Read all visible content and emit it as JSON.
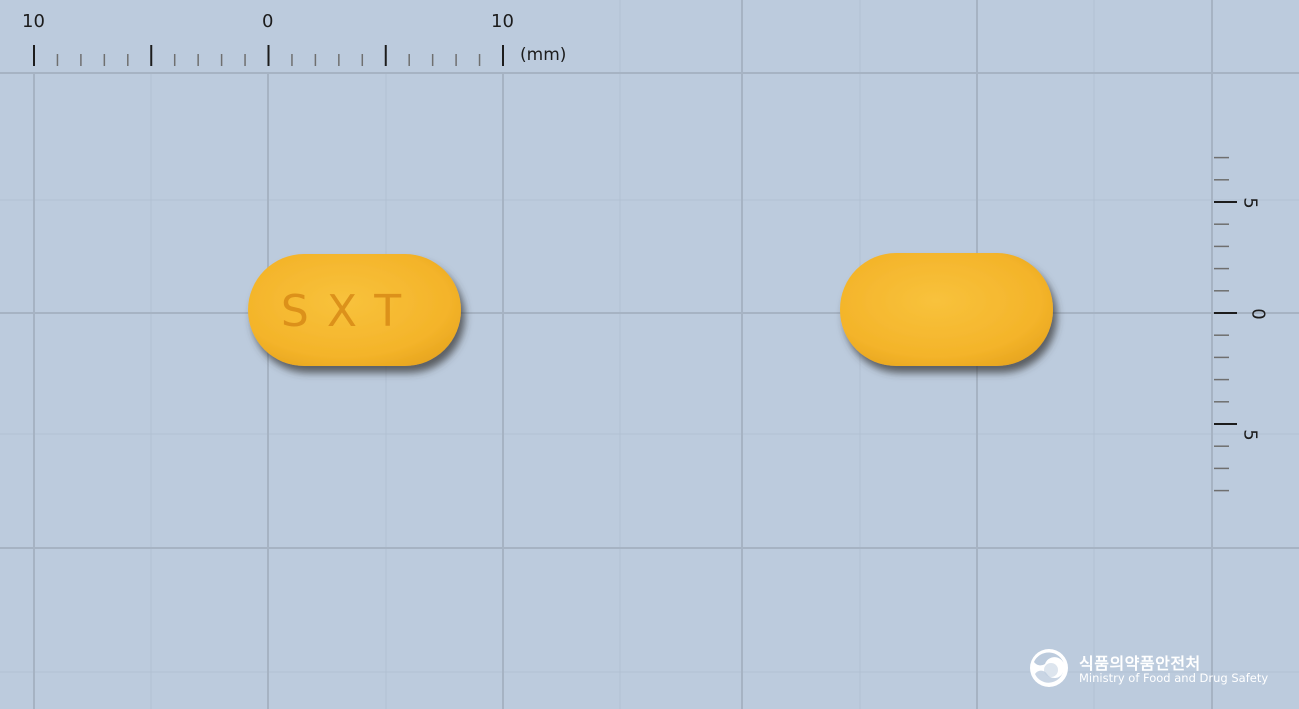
{
  "ruler_top": {
    "labels": [
      "10",
      "0",
      "10"
    ],
    "unit": "(mm)"
  },
  "ruler_right": {
    "labels": [
      "5",
      "0",
      "5"
    ]
  },
  "tablet_front": {
    "imprint": "SXT",
    "color": "#f5b629"
  },
  "tablet_back": {
    "imprint": "",
    "color": "#f5b629"
  },
  "logo": {
    "icon": "government-emblem-icon",
    "title_korean": "식품의약품안전처",
    "title_english": "Ministry of Food and Drug Safety"
  },
  "colors": {
    "background": "#bccbdd",
    "grid_major": "#a6b3c3",
    "grid_minor": "#b2c0d2",
    "tablet": "#f5b629"
  }
}
